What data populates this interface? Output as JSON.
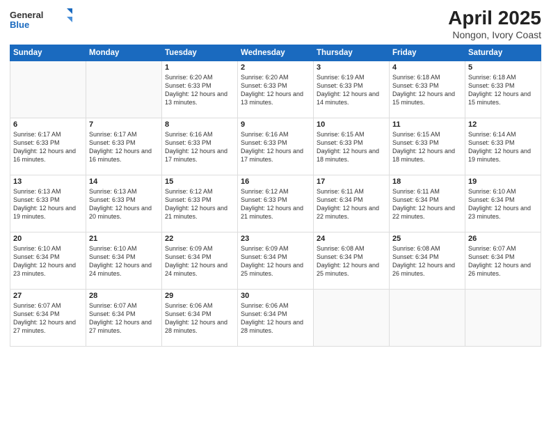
{
  "header": {
    "logo_general": "General",
    "logo_blue": "Blue",
    "month": "April 2025",
    "location": "Nongon, Ivory Coast"
  },
  "days_of_week": [
    "Sunday",
    "Monday",
    "Tuesday",
    "Wednesday",
    "Thursday",
    "Friday",
    "Saturday"
  ],
  "weeks": [
    [
      {
        "day": "",
        "info": ""
      },
      {
        "day": "",
        "info": ""
      },
      {
        "day": "1",
        "info": "Sunrise: 6:20 AM\nSunset: 6:33 PM\nDaylight: 12 hours and 13 minutes."
      },
      {
        "day": "2",
        "info": "Sunrise: 6:20 AM\nSunset: 6:33 PM\nDaylight: 12 hours and 13 minutes."
      },
      {
        "day": "3",
        "info": "Sunrise: 6:19 AM\nSunset: 6:33 PM\nDaylight: 12 hours and 14 minutes."
      },
      {
        "day": "4",
        "info": "Sunrise: 6:18 AM\nSunset: 6:33 PM\nDaylight: 12 hours and 15 minutes."
      },
      {
        "day": "5",
        "info": "Sunrise: 6:18 AM\nSunset: 6:33 PM\nDaylight: 12 hours and 15 minutes."
      }
    ],
    [
      {
        "day": "6",
        "info": "Sunrise: 6:17 AM\nSunset: 6:33 PM\nDaylight: 12 hours and 16 minutes."
      },
      {
        "day": "7",
        "info": "Sunrise: 6:17 AM\nSunset: 6:33 PM\nDaylight: 12 hours and 16 minutes."
      },
      {
        "day": "8",
        "info": "Sunrise: 6:16 AM\nSunset: 6:33 PM\nDaylight: 12 hours and 17 minutes."
      },
      {
        "day": "9",
        "info": "Sunrise: 6:16 AM\nSunset: 6:33 PM\nDaylight: 12 hours and 17 minutes."
      },
      {
        "day": "10",
        "info": "Sunrise: 6:15 AM\nSunset: 6:33 PM\nDaylight: 12 hours and 18 minutes."
      },
      {
        "day": "11",
        "info": "Sunrise: 6:15 AM\nSunset: 6:33 PM\nDaylight: 12 hours and 18 minutes."
      },
      {
        "day": "12",
        "info": "Sunrise: 6:14 AM\nSunset: 6:33 PM\nDaylight: 12 hours and 19 minutes."
      }
    ],
    [
      {
        "day": "13",
        "info": "Sunrise: 6:13 AM\nSunset: 6:33 PM\nDaylight: 12 hours and 19 minutes."
      },
      {
        "day": "14",
        "info": "Sunrise: 6:13 AM\nSunset: 6:33 PM\nDaylight: 12 hours and 20 minutes."
      },
      {
        "day": "15",
        "info": "Sunrise: 6:12 AM\nSunset: 6:33 PM\nDaylight: 12 hours and 21 minutes."
      },
      {
        "day": "16",
        "info": "Sunrise: 6:12 AM\nSunset: 6:33 PM\nDaylight: 12 hours and 21 minutes."
      },
      {
        "day": "17",
        "info": "Sunrise: 6:11 AM\nSunset: 6:34 PM\nDaylight: 12 hours and 22 minutes."
      },
      {
        "day": "18",
        "info": "Sunrise: 6:11 AM\nSunset: 6:34 PM\nDaylight: 12 hours and 22 minutes."
      },
      {
        "day": "19",
        "info": "Sunrise: 6:10 AM\nSunset: 6:34 PM\nDaylight: 12 hours and 23 minutes."
      }
    ],
    [
      {
        "day": "20",
        "info": "Sunrise: 6:10 AM\nSunset: 6:34 PM\nDaylight: 12 hours and 23 minutes."
      },
      {
        "day": "21",
        "info": "Sunrise: 6:10 AM\nSunset: 6:34 PM\nDaylight: 12 hours and 24 minutes."
      },
      {
        "day": "22",
        "info": "Sunrise: 6:09 AM\nSunset: 6:34 PM\nDaylight: 12 hours and 24 minutes."
      },
      {
        "day": "23",
        "info": "Sunrise: 6:09 AM\nSunset: 6:34 PM\nDaylight: 12 hours and 25 minutes."
      },
      {
        "day": "24",
        "info": "Sunrise: 6:08 AM\nSunset: 6:34 PM\nDaylight: 12 hours and 25 minutes."
      },
      {
        "day": "25",
        "info": "Sunrise: 6:08 AM\nSunset: 6:34 PM\nDaylight: 12 hours and 26 minutes."
      },
      {
        "day": "26",
        "info": "Sunrise: 6:07 AM\nSunset: 6:34 PM\nDaylight: 12 hours and 26 minutes."
      }
    ],
    [
      {
        "day": "27",
        "info": "Sunrise: 6:07 AM\nSunset: 6:34 PM\nDaylight: 12 hours and 27 minutes."
      },
      {
        "day": "28",
        "info": "Sunrise: 6:07 AM\nSunset: 6:34 PM\nDaylight: 12 hours and 27 minutes."
      },
      {
        "day": "29",
        "info": "Sunrise: 6:06 AM\nSunset: 6:34 PM\nDaylight: 12 hours and 28 minutes."
      },
      {
        "day": "30",
        "info": "Sunrise: 6:06 AM\nSunset: 6:34 PM\nDaylight: 12 hours and 28 minutes."
      },
      {
        "day": "",
        "info": ""
      },
      {
        "day": "",
        "info": ""
      },
      {
        "day": "",
        "info": ""
      }
    ]
  ]
}
